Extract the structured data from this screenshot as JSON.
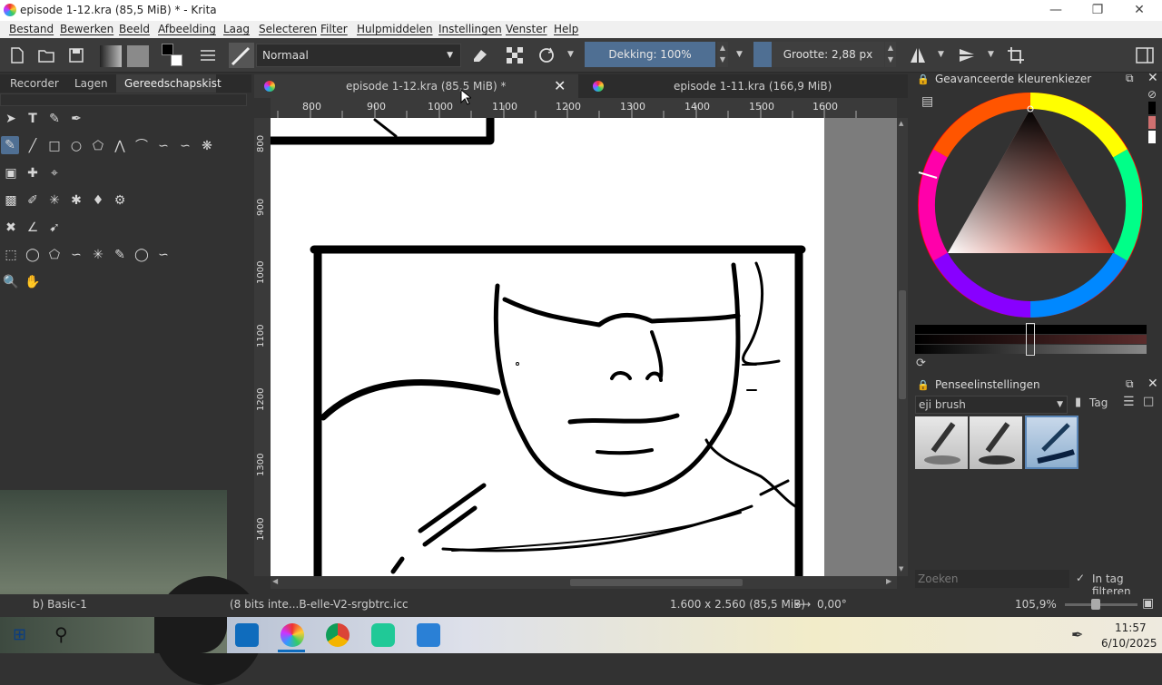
{
  "window": {
    "title": "episode 1-12.kra (85,5 MiB) * - Krita",
    "controls": [
      "minimize",
      "restore",
      "close"
    ]
  },
  "menubar": {
    "items": [
      "Bestand",
      "Bewerken",
      "Beeld",
      "Afbeelding",
      "Laag",
      "Selecteren",
      "Filter",
      "Hulpmiddelen",
      "Instellingen",
      "Venster",
      "Help"
    ]
  },
  "toolbar": {
    "blend_mode": "Normaal",
    "opacity_label": "Dekking: 100%",
    "size_label": "Grootte: 2,88 px"
  },
  "left_panel": {
    "tabs": [
      "Recorder",
      "Lagen",
      "Gereedschapskist"
    ],
    "active_tab": "Gereedschapskist"
  },
  "document_tabs": [
    {
      "label": "episode 1-12.kra (85,5 MiB) *",
      "active": true
    },
    {
      "label": "episode 1-11.kra (166,9 MiB)",
      "active": false
    }
  ],
  "rulers": {
    "top_ticks": [
      "800",
      "900",
      "1000",
      "1100",
      "1200",
      "1300",
      "1400",
      "1500",
      "1600"
    ],
    "left_ticks": [
      "800",
      "900",
      "1000",
      "1100",
      "1200",
      "1300",
      "1400"
    ]
  },
  "color_selector": {
    "title": "Geavanceerde kleurenkiezer",
    "current_color": "#cc3322"
  },
  "brush_settings": {
    "title": "Penseelinstellingen",
    "tag": "eji brush",
    "tag_button": "Tag",
    "search_placeholder": "Zoeken",
    "filter_label": "In tag filteren"
  },
  "statusbar": {
    "brush_name": "b) Basic-1",
    "color_profile": "(8 bits inte...B-elle-V2-srgbtrc.icc",
    "image_size": "1.600 x 2.560 (85,5 MiB)",
    "rotation": "0,00°",
    "zoom": "105,9%"
  },
  "clock": {
    "time": "11:57",
    "date": "6/10/2025"
  },
  "colors": {
    "accent": "#4f6f93",
    "panel_bg": "#323232",
    "canvas_bg": "#ffffff"
  }
}
